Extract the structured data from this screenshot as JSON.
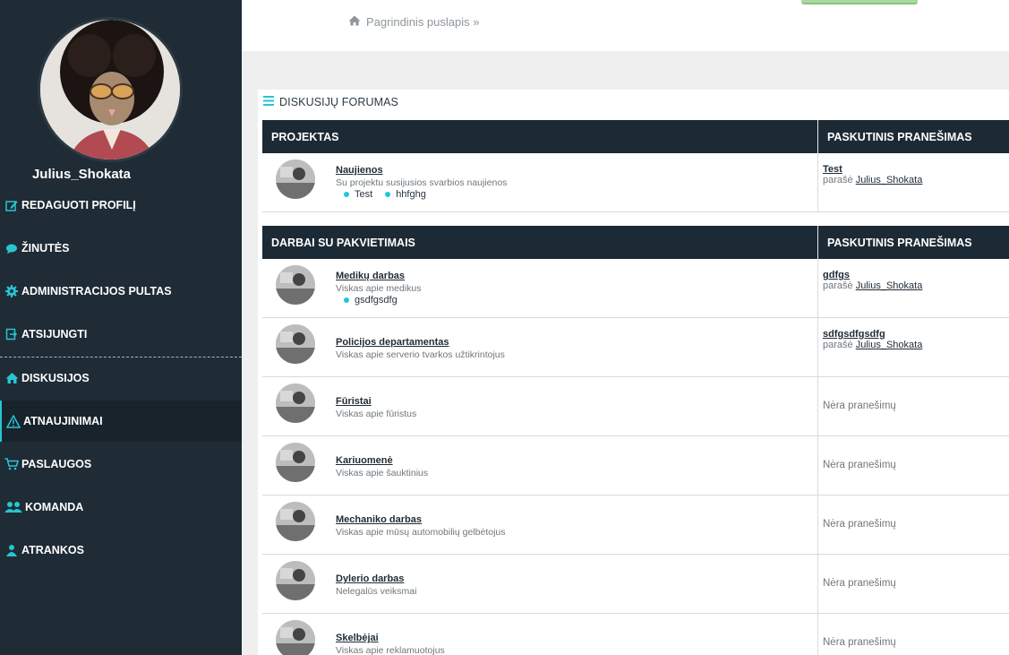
{
  "user": {
    "name": "Julius_Shokata"
  },
  "nav": [
    {
      "label": "REDAGUOTI PROFILĮ",
      "icon": "edit-icon",
      "name": "nav-edit-profile"
    },
    {
      "label": "ŽINUTĖS",
      "icon": "chat-icon",
      "name": "nav-messages"
    },
    {
      "label": "ADMINISTRACIJOS PULTAS",
      "icon": "gear-icon",
      "name": "nav-admin-panel"
    },
    {
      "label": "ATSIJUNGTI",
      "icon": "logout-icon",
      "name": "nav-logout"
    },
    {
      "label": "DISKUSIJOS",
      "icon": "home-icon",
      "name": "nav-discussions"
    },
    {
      "label": "ATNAUJINIMAI",
      "icon": "warning-icon",
      "name": "nav-updates"
    },
    {
      "label": "PASLAUGOS",
      "icon": "cart-icon",
      "name": "nav-services"
    },
    {
      "label": "KOMANDA",
      "icon": "users-icon",
      "name": "nav-team"
    },
    {
      "label": "ATRANKOS",
      "icon": "user-icon",
      "name": "nav-recruitment"
    }
  ],
  "breadcrumb": {
    "text": "Pagrindinis puslapis »"
  },
  "forum": {
    "title": "DISKUSIJŲ FORUMAS",
    "sections": [
      {
        "col_main": "PROJEKTAS",
        "col_last": "PASKUTINIS PRANEŠIMAS",
        "rows": [
          {
            "name": "Naujienos",
            "desc": "Su projektu susijusios svarbios naujienos",
            "tags": [
              "Test",
              "hhfghg"
            ],
            "last_title": "Test",
            "by_prefix": "parašė",
            "by_user": "Julius_Shokata"
          }
        ]
      },
      {
        "col_main": "DARBAI SU PAKVIETIMAIS",
        "col_last": "PASKUTINIS PRANEŠIMAS",
        "rows": [
          {
            "name": "Medikų darbas",
            "desc": "Viskas apie medikus",
            "tags": [
              "gsdfgsdfg"
            ],
            "last_title": "gdfgs",
            "by_prefix": "parašė",
            "by_user": "Julius_Shokata"
          },
          {
            "name": "Policijos departamentas",
            "desc": "Viskas apie serverio tvarkos užtikrintojus",
            "tags": [],
            "last_title": "sdfgsdfgsdfg",
            "by_prefix": "parašė",
            "by_user": "Julius_Shokata"
          },
          {
            "name": "Fūristai",
            "desc": "Viskas apie fūristus",
            "tags": [],
            "no_posts": "Nėra pranešimų"
          },
          {
            "name": "Kariuomenė",
            "desc": "Viskas apie šauktinius",
            "tags": [],
            "no_posts": "Nėra pranešimų"
          },
          {
            "name": "Mechaniko darbas",
            "desc": "Viskas apie mūsų automobilių gelbėtojus",
            "tags": [],
            "no_posts": "Nėra pranešimų"
          },
          {
            "name": "Dylerio darbas",
            "desc": "Nelegalūs veiksmai",
            "tags": [],
            "no_posts": "Nėra pranešimų"
          },
          {
            "name": "Skelbėjai",
            "desc": "Viskas apie reklamuotojus",
            "tags": [],
            "no_posts": "Nėra pranešimų"
          }
        ]
      }
    ]
  },
  "colors": {
    "sidebar": "#1f2b35",
    "accent": "#27c5d3",
    "header": "#1c2a35"
  }
}
